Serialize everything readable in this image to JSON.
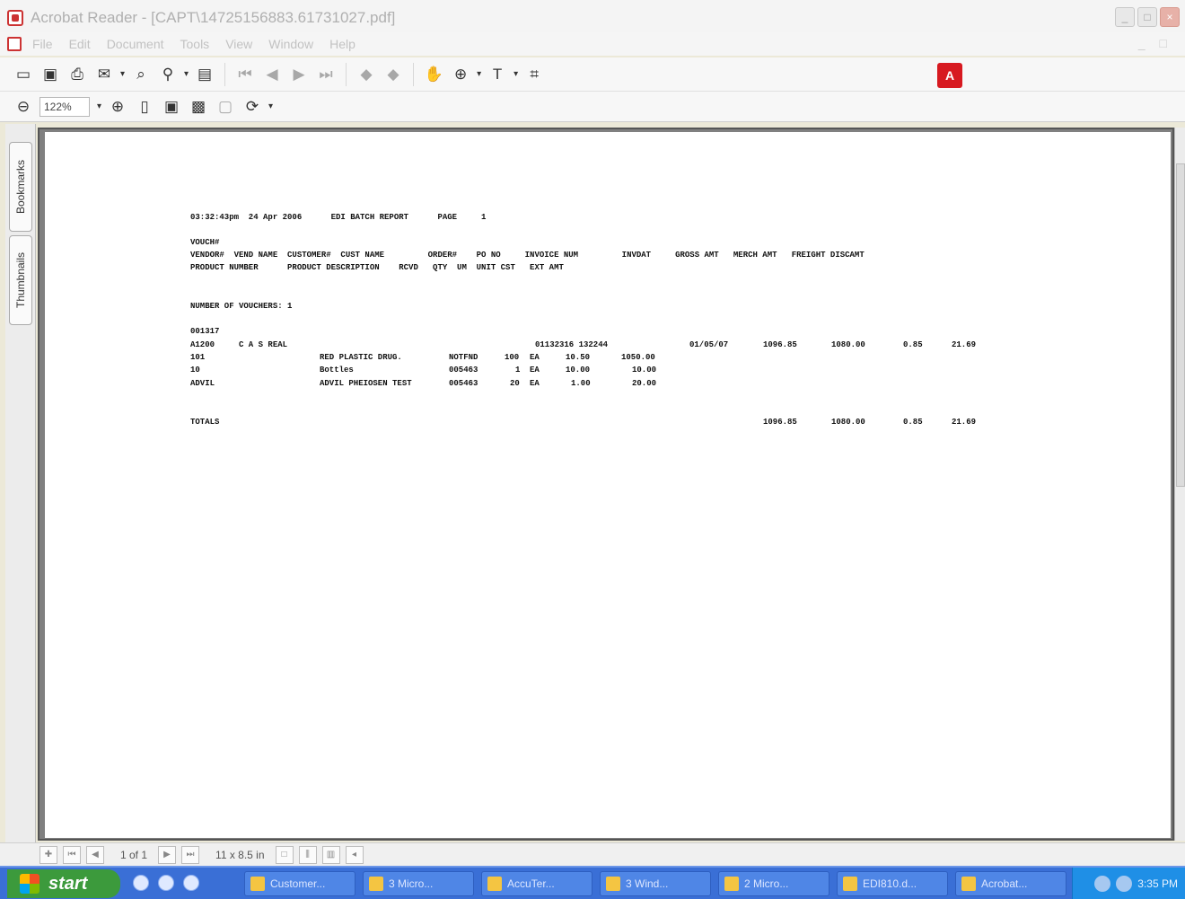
{
  "window": {
    "title": "Acrobat Reader - [CAPT\\14725156883.61731027.pdf]",
    "min": "_",
    "max": "□",
    "close": "×"
  },
  "menu": {
    "items": [
      "File",
      "Edit",
      "Document",
      "Tools",
      "View",
      "Window",
      "Help"
    ],
    "right": "_ □"
  },
  "toolbar": {
    "zoom_value": "122%",
    "adobe_logo": "A"
  },
  "navpane": {
    "bookmarks": "Bookmarks",
    "thumbnails": "Thumbnails"
  },
  "report": {
    "header": "03:32:43pm  24 Apr 2006      EDI BATCH REPORT      PAGE     1",
    "col_row1": "VOUCH#",
    "col_row2": "VENDOR#  VEND NAME  CUSTOMER#  CUST NAME         ORDER#    PO NO     INVOICE NUM         INVDAT     GROSS AMT   MERCH AMT   FREIGHT DISCAMT",
    "col_row3": "PRODUCT NUMBER      PRODUCT DESCRIPTION    RCVD   QTY  UM  UNIT CST   EXT AMT",
    "num_vouchers": "NUMBER OF VOUCHERS: 1",
    "voucher_no": "001317",
    "vendor_line_left": "A1200     C A S REAL",
    "vendor_line_invoice": "01132316 132244",
    "vendor_line_invdat": "01/05/07",
    "vendor_line_gross": "1096.85",
    "vendor_line_merch": "1080.00",
    "vendor_line_freight": "0.85",
    "vendor_line_discamt": "21.69",
    "items": [
      {
        "num": "101",
        "desc": "RED PLASTIC DRUG.",
        "rcvd": "NOTFND",
        "qty": "100",
        "um": "EA",
        "unit": "10.50",
        "ext": "1050.00"
      },
      {
        "num": "10",
        "desc": "Bottles",
        "rcvd": "005463",
        "qty": "1",
        "um": "EA",
        "unit": "10.00",
        "ext": "10.00"
      },
      {
        "num": "ADVIL",
        "desc": "ADVIL PHEIOSEN TEST",
        "rcvd": "005463",
        "qty": "20",
        "um": "EA",
        "unit": "1.00",
        "ext": "20.00"
      }
    ],
    "totals_label": "TOTALS",
    "totals_gross": "1096.85",
    "totals_merch": "1080.00",
    "totals_freight": "0.85",
    "totals_discamt": "21.69"
  },
  "statusbar": {
    "page_info": "1 of 1",
    "page_size": "11 x 8.5 in"
  },
  "taskbar": {
    "start": "start",
    "tasks": [
      "Customer...",
      "3 Micro...",
      "AccuTer...",
      "3 Wind...",
      "2 Micro...",
      "EDI810.d...",
      "Acrobat..."
    ],
    "clock": "3:35 PM"
  }
}
